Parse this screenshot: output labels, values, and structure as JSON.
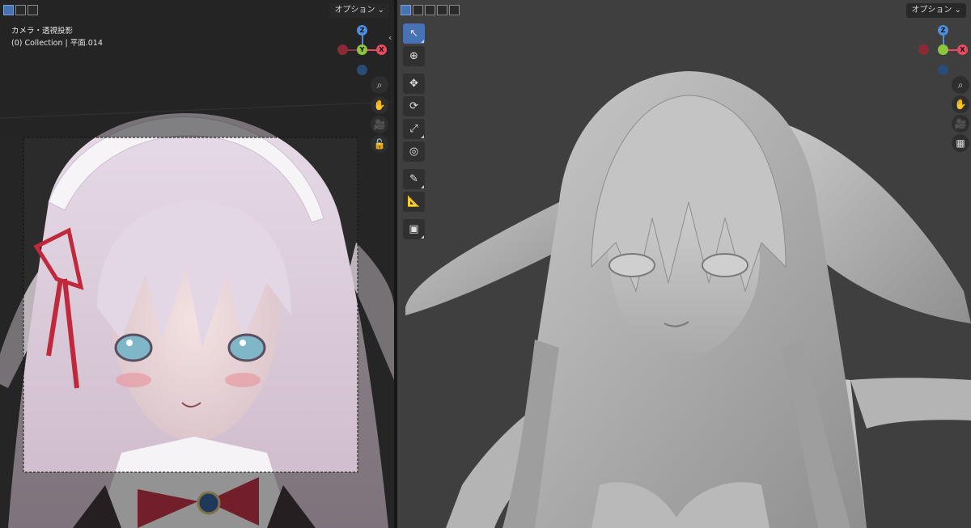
{
  "left_viewport": {
    "options_label": "オプション ⌄",
    "camera_info": "カメラ・透視投影",
    "collection_info": "(0) Collection | 平面.014",
    "gizmo": {
      "z": "Z",
      "y": "Y",
      "x": "X"
    },
    "nav_icons": [
      "zoom-icon",
      "hand-pan-icon",
      "camera-icon",
      "lock-icon"
    ],
    "collapse_arrow": "‹"
  },
  "right_viewport": {
    "options_label": "オプション ⌄",
    "gizmo": {
      "z": "Z",
      "y": "Y",
      "x": "X"
    },
    "nav_icons": [
      "zoom-icon",
      "hand-pan-icon",
      "camera-icon",
      "perspective-grid-icon"
    ],
    "tools": [
      {
        "name": "select-tool",
        "glyph": "↖",
        "active": true
      },
      {
        "name": "cursor-tool",
        "glyph": "⊕",
        "active": false
      },
      {
        "name": "move-tool",
        "glyph": "✥",
        "active": false
      },
      {
        "name": "rotate-tool",
        "glyph": "⟳",
        "active": false
      },
      {
        "name": "scale-tool",
        "glyph": "⤢",
        "active": false
      },
      {
        "name": "transform-tool",
        "glyph": "◎",
        "active": false
      },
      {
        "name": "annotate-tool",
        "glyph": "✎",
        "active": false
      },
      {
        "name": "measure-tool",
        "glyph": "📐",
        "active": false
      },
      {
        "name": "add-cube-tool",
        "glyph": "▣",
        "active": false
      }
    ]
  },
  "colors": {
    "accent": "#4772b3",
    "axis_x": "#e84a5f",
    "axis_y": "#8cc63f",
    "axis_z": "#4b8ed9"
  }
}
